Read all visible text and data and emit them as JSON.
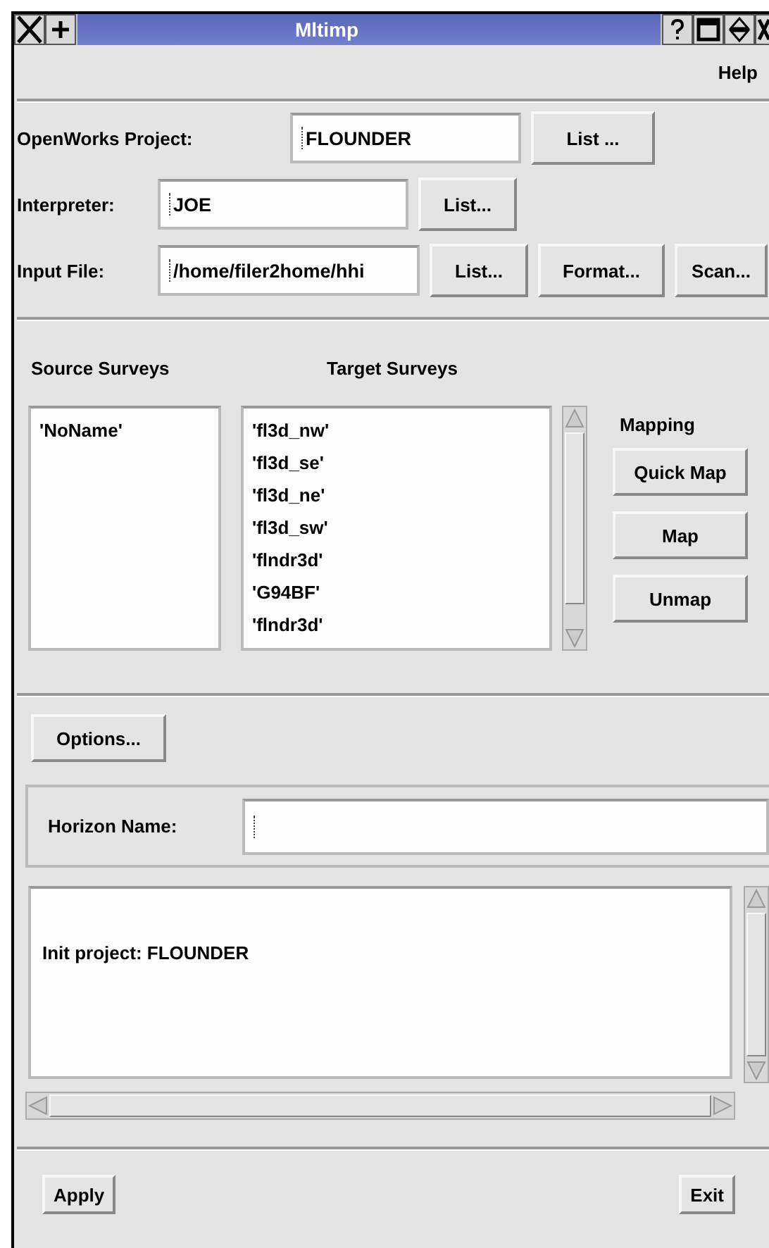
{
  "window": {
    "title": "Mltimp"
  },
  "menu": [
    "Help"
  ],
  "fields": [
    {
      "label": "OpenWorks Project:",
      "value": "FLOUNDER",
      "buttons": [
        "List ..."
      ]
    },
    {
      "label": "Interpreter:",
      "value": "JOE",
      "buttons": [
        "List..."
      ]
    },
    {
      "label": "Input File:",
      "value": "/home/filer2home/hhi",
      "buttons": [
        "List...",
        "Format...",
        "Scan..."
      ]
    }
  ],
  "source_surveys": {
    "heading": "Source Surveys",
    "items": [
      "'NoName'"
    ]
  },
  "target_surveys": {
    "heading": "Target Surveys",
    "items": [
      "'fl3d_nw'",
      "'fl3d_se'",
      "'fl3d_ne'",
      "'fl3d_sw'",
      "'flndr3d'",
      "'G94BF'",
      "'flndr3d'"
    ]
  },
  "mapping": {
    "label": "Mapping",
    "buttons": [
      "Quick Map",
      "Map",
      "Unmap"
    ]
  },
  "options_button": "Options...",
  "horizon": {
    "label": "Horizon Name:"
  },
  "log": [
    "Init project: FLOUNDER"
  ],
  "buttons": [
    "Apply",
    "Exit"
  ]
}
